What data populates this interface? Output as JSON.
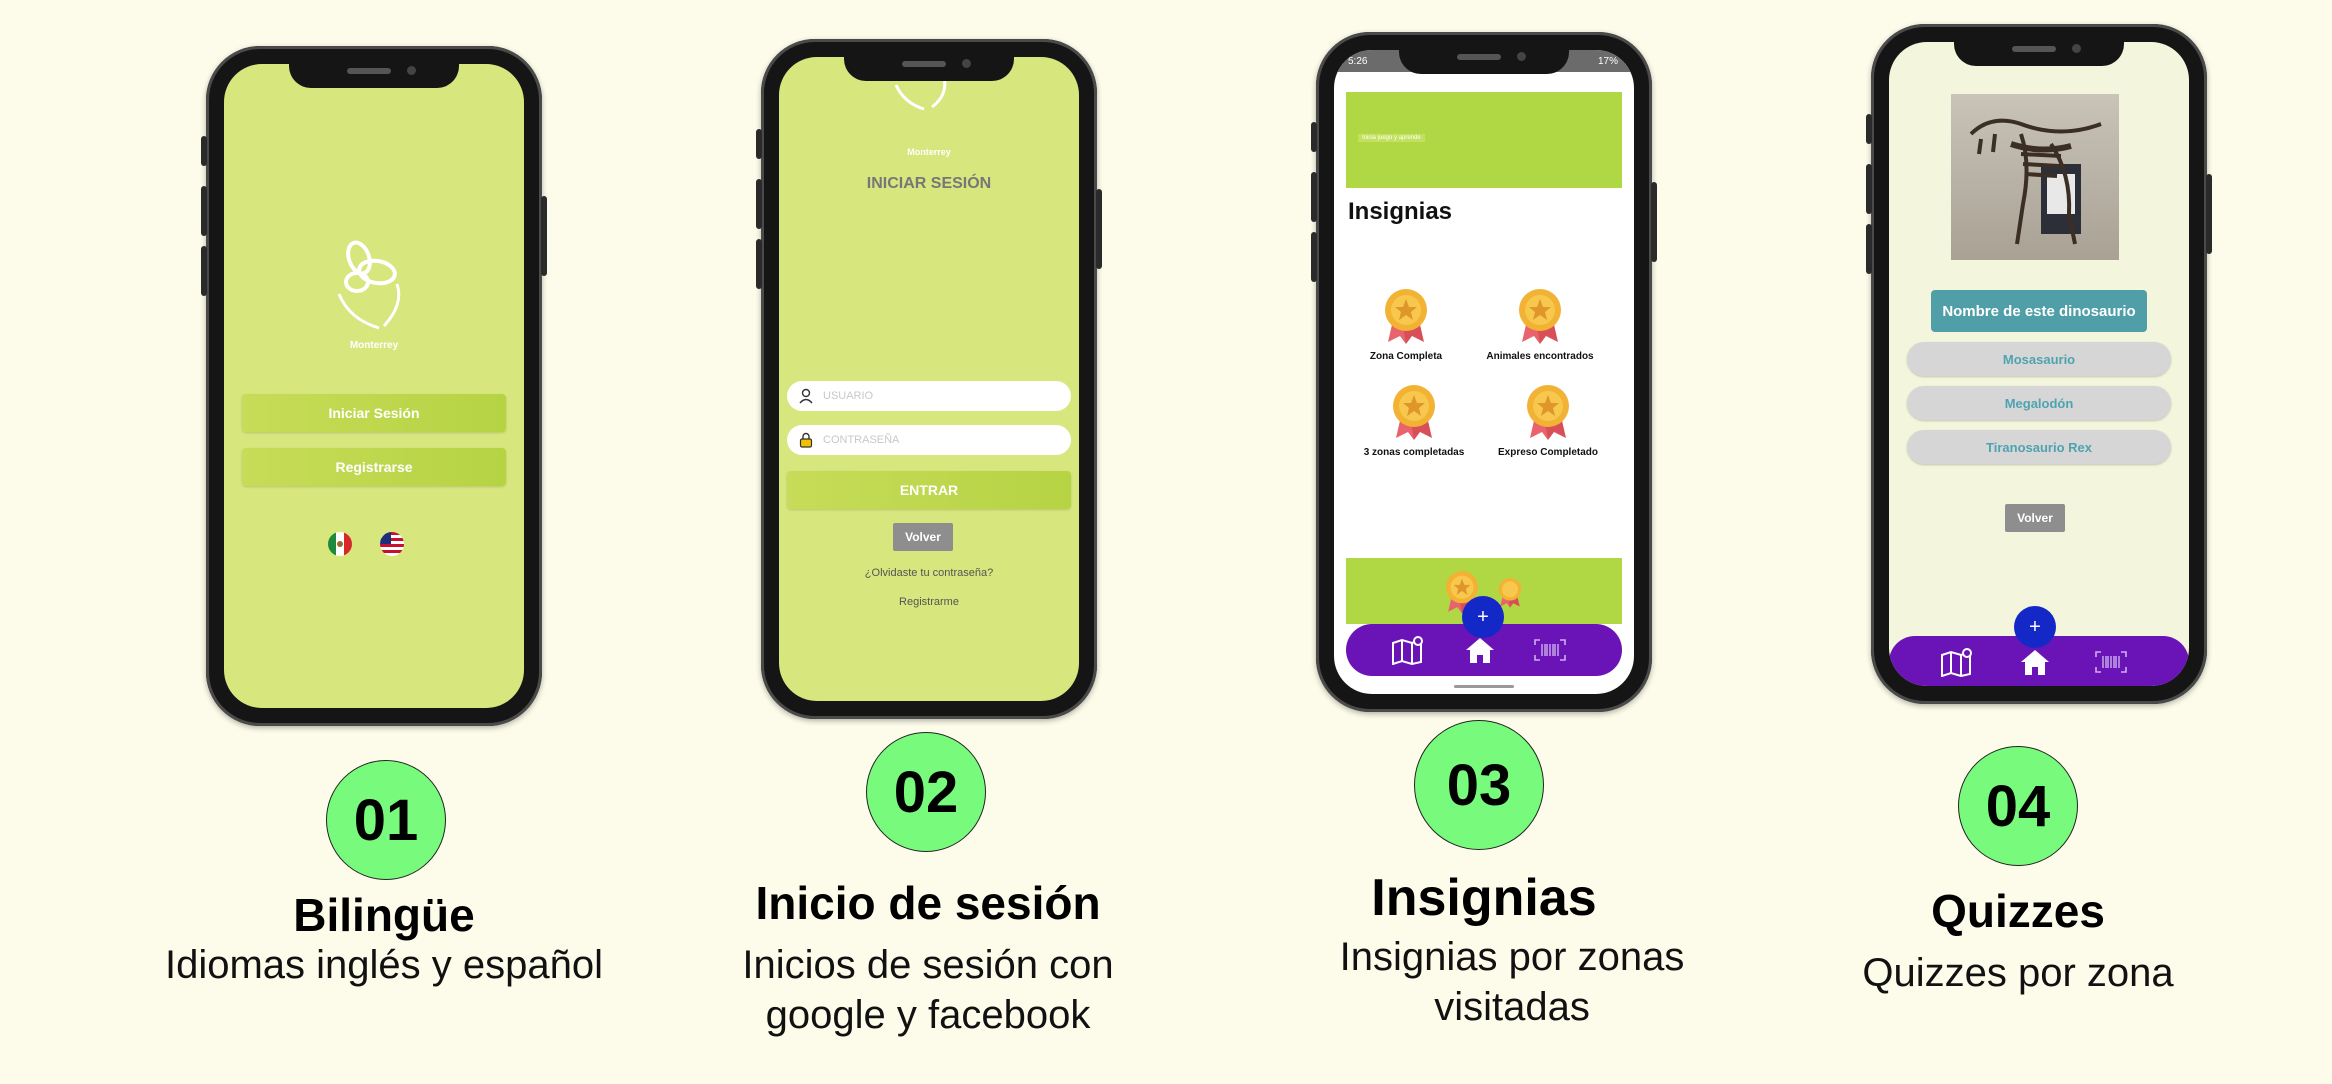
{
  "colors": {
    "background": "#fdfcea",
    "badge": "#78fb7d",
    "app_green": "#d8e67e",
    "nav_purple": "#6a14b8",
    "fab_blue": "#1428c8"
  },
  "features": [
    {
      "number": "01",
      "title": "Bilingüe",
      "desc_lines": [
        "Idiomas inglés y español"
      ]
    },
    {
      "number": "02",
      "title": "Inicio de sesión",
      "desc_lines": [
        "Inicios de sesión con",
        "google y facebook"
      ]
    },
    {
      "number": "03",
      "title": "Insignias",
      "desc_lines": [
        "Insignias por zonas",
        "visitadas"
      ]
    },
    {
      "number": "04",
      "title": "Quizzes",
      "desc_lines": [
        "Quizzes por zona"
      ]
    }
  ],
  "screen1": {
    "logo_text": "Monterrey",
    "login_button": "Iniciar Sesión",
    "register_button": "Registrarse",
    "lang_icons": [
      "mexico-flag-icon",
      "usa-flag-icon"
    ]
  },
  "screen2": {
    "logo_text": "Monterrey",
    "heading": "INICIAR SESIÓN",
    "user_placeholder": "USUARIO",
    "password_placeholder": "CONTRASEÑA",
    "enter_button": "ENTRAR",
    "back_button": "Volver",
    "forgot_link": "¿Olvidaste tu contraseña?",
    "register_link": "Registrarme"
  },
  "screen3": {
    "status_time": "5:26",
    "status_battery": "17%",
    "banner_text": "Inicia juego y aprende",
    "heading": "Insignias",
    "badges": [
      "Zona Completa",
      "Animales encontrados",
      "3 zonas completadas",
      "Expreso Completado"
    ],
    "fab_label": "+"
  },
  "screen4": {
    "question": "Nombre de este dinosaurio",
    "options": [
      "Mosasaurio",
      "Megalodón",
      "Tiranosaurio Rex"
    ],
    "back_button": "Volver",
    "fab_label": "+"
  }
}
